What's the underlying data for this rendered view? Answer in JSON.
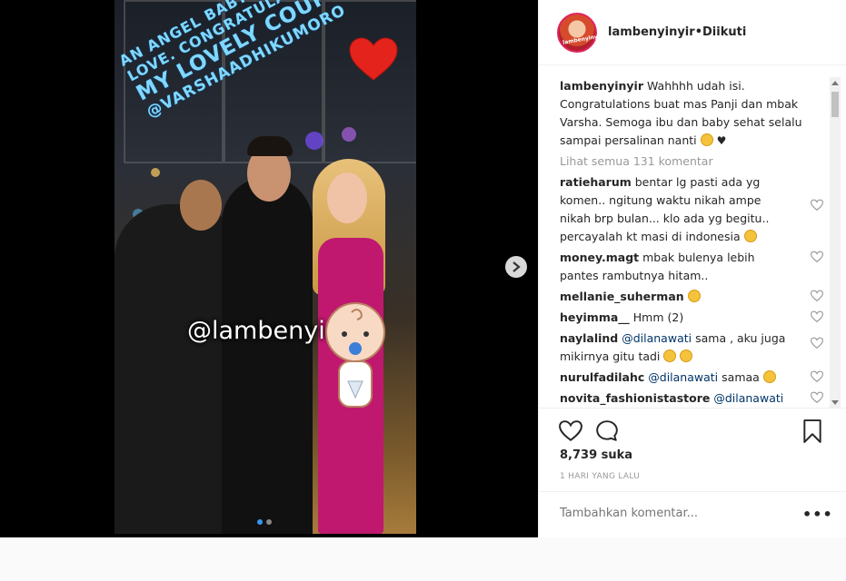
{
  "post": {
    "overlay_text": [
      "AN ANGEL BABY WAITING FOR",
      "LOVE. CONGRATULATIONS TO",
      "MY LOVELY COUPLE",
      "@VARSHAADHIKUMORO"
    ],
    "watermark": "@lambenyinyir",
    "next_icon": "chevron-right-icon"
  },
  "header": {
    "username": "lambenyinyir",
    "separator": " • ",
    "follow_status": "Diikuti"
  },
  "caption": {
    "username": "lambenyinyir",
    "text": "Wahhhh udah isi. Congratulations buat mas Panji dan mbak Varsha. Semoga ibu dan baby sehat selalu sampai persalinan nanti"
  },
  "view_all": "Lihat semua 131 komentar",
  "comments": [
    {
      "user": "ratieharum",
      "pre": "",
      "mention": "",
      "text": "bentar lg pasti ada yg komen.. ngitung waktu nikah ampe nikah brp bulan... klo ada yg begitu.. percayalah kt masi di indonesia"
    },
    {
      "user": "money.magt",
      "pre": "",
      "mention": "",
      "text": "mbak bulenya lebih pantes rambutnya hitam.."
    },
    {
      "user": "mellanie_suherman",
      "pre": "",
      "mention": "",
      "text": ""
    },
    {
      "user": "heyimma__",
      "pre": "",
      "mention": "",
      "text": "Hmm (2)"
    },
    {
      "user": "naylalind",
      "pre": "",
      "mention": "@dilanawati",
      "text": "sama , aku juga mikirnya gitu tadi"
    },
    {
      "user": "nurulfadilahc",
      "pre": "",
      "mention": "@dilanawati",
      "text": "samaa"
    },
    {
      "user": "novita_fashionistastore",
      "pre": "",
      "mention": "@dilanawati",
      "text": ""
    }
  ],
  "likes": "8,739 suka",
  "timestamp": "1 HARI YANG LALU",
  "add_comment_placeholder": "Tambahkan komentar...",
  "more_label": "•••"
}
